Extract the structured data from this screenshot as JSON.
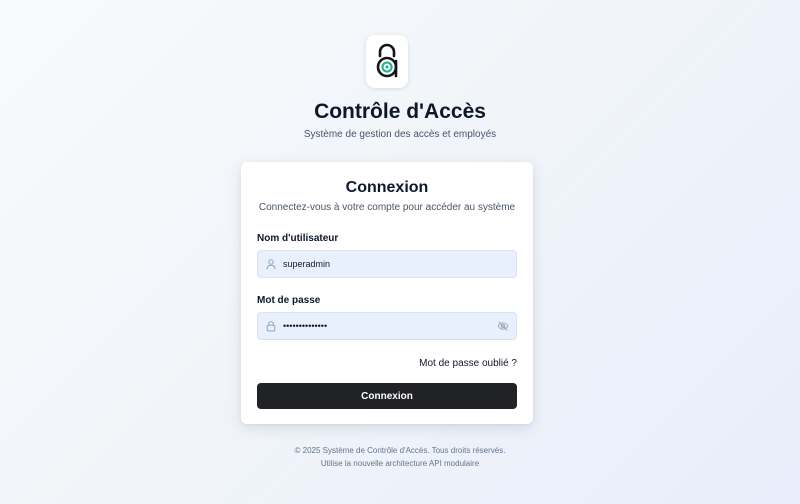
{
  "brand": {
    "logo_icon": "padlock-a-logo-icon",
    "title": "Contrôle d'Accès",
    "subtitle": "Système de gestion des accès et employés"
  },
  "login": {
    "title": "Connexion",
    "subtitle": "Connectez-vous à votre compte pour accéder au système",
    "username": {
      "label": "Nom d'utilisateur",
      "value": "superadmin",
      "icon": "user-icon"
    },
    "password": {
      "label": "Mot de passe",
      "value": "superadmin1234",
      "icon": "lock-icon",
      "toggle_icon": "eye-off-icon"
    },
    "forgot_link": "Mot de passe oublié ?",
    "submit_label": "Connexion"
  },
  "footer": {
    "copyright": "© 2025 Système de Contrôle d'Accès. Tous droits réservés.",
    "note": "Utilise la nouvelle architecture API modulaire"
  },
  "colors": {
    "primary_button": "#212226",
    "logo_accent": "#2bb39a",
    "input_background": "#e8f0fe"
  }
}
